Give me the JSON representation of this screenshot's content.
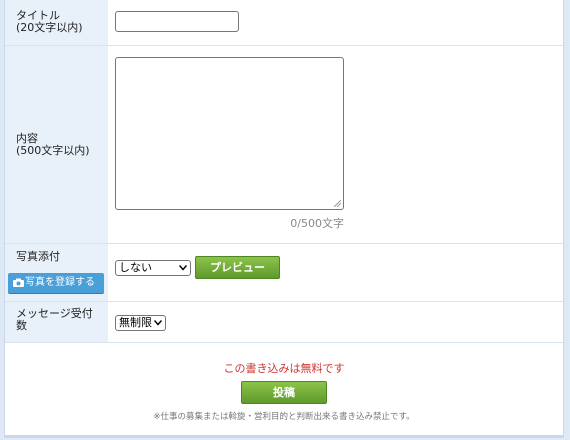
{
  "form": {
    "title_label_line1": "タイトル",
    "title_label_line2": "(20文字以内)",
    "content_label_line1": "内容",
    "content_label_line2": "(500文字以内)",
    "content_counter": "0/500文字",
    "photo_label": "写真添付",
    "photo_register_button": "写真を登録する",
    "photo_select_value": "しない",
    "preview_button": "プレビュー",
    "message_label_line1": "メッセージ受付",
    "message_label_line2": "数",
    "message_select_value": "無制限"
  },
  "footer": {
    "free_text": "この書き込みは無料です",
    "submit_button": "投稿",
    "notice": "※仕事の募集または斡旋・営利目的と判断出来る書き込み禁止です。"
  },
  "colors": {
    "label_bg": "#e8f0fa",
    "button_green": "#6fa93a",
    "button_blue": "#4a9fd8",
    "free_text_red": "#d2322d"
  }
}
